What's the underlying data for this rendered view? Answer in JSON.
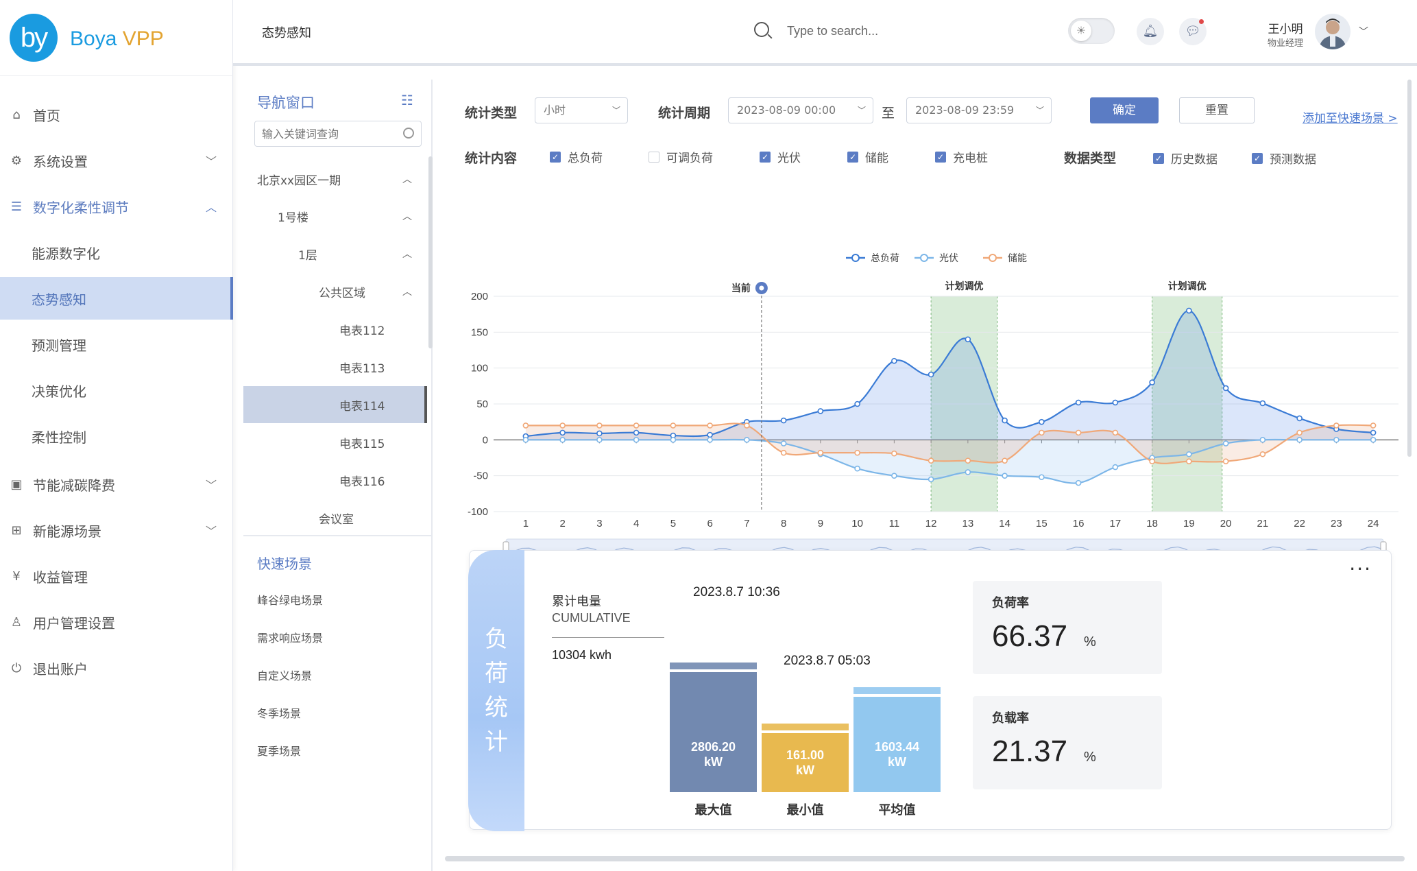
{
  "app": {
    "logo_mark": "by",
    "brand_part1": "Boya",
    "brand_part2": "VPP",
    "brand_color": "#1a9be0",
    "brand_accent": "#e3a431"
  },
  "sidebar": {
    "items": [
      {
        "label": "首页",
        "icon": "home-icon"
      },
      {
        "label": "系统设置",
        "icon": "gear-icon"
      },
      {
        "label": "数字化柔性调节",
        "icon": "sliders-icon"
      },
      {
        "label": "能源数字化"
      },
      {
        "label": "态势感知"
      },
      {
        "label": "预测管理"
      },
      {
        "label": "决策优化"
      },
      {
        "label": "柔性控制"
      },
      {
        "label": "节能减碳降费",
        "icon": "calendar-icon"
      },
      {
        "label": "新能源场景",
        "icon": "grid-icon"
      },
      {
        "label": "收益管理",
        "icon": "yen-icon"
      },
      {
        "label": "用户管理设置",
        "icon": "user-icon"
      },
      {
        "label": "退出账户",
        "icon": "power-icon"
      }
    ]
  },
  "topbar": {
    "title": "态势感知",
    "search_placeholder": "Type to search...",
    "user_name": "王小明",
    "user_role": "物业经理"
  },
  "navpanel": {
    "title": "导航窗口",
    "search_placeholder": "输入关键词查询",
    "tree": [
      "北京xx园区一期",
      "1号楼",
      "1层",
      "公共区域",
      "电表112",
      "电表113",
      "电表114",
      "电表115",
      "电表116",
      "会议室"
    ],
    "quick_title": "快速场景",
    "quick_items": [
      "峰谷绿电场景",
      "需求响应场景",
      "自定义场景",
      "冬季场景",
      "夏季场景"
    ]
  },
  "filters": {
    "stat_type_label": "统计类型",
    "stat_type_value": "小时",
    "period_label": "统计周期",
    "period_start": "2023-08-09 00:00",
    "period_sep": "至",
    "period_end": "2023-08-09 23:59",
    "confirm": "确定",
    "reset": "重置",
    "add_quick": "添加至快速场景 >",
    "content_label": "统计内容",
    "content_options": [
      {
        "label": "总负荷",
        "checked": true
      },
      {
        "label": "可调负荷",
        "checked": false
      },
      {
        "label": "光伏",
        "checked": true
      },
      {
        "label": "储能",
        "checked": true
      },
      {
        "label": "充电桩",
        "checked": true
      }
    ],
    "data_type_label": "数据类型",
    "data_type_options": [
      {
        "label": "历史数据",
        "checked": true
      },
      {
        "label": "预测数据",
        "checked": true
      }
    ]
  },
  "chart_data": {
    "type": "line",
    "x": [
      1,
      2,
      3,
      4,
      5,
      6,
      7,
      8,
      9,
      10,
      11,
      12,
      13,
      14,
      15,
      16,
      17,
      18,
      19,
      20,
      21,
      22,
      23,
      24
    ],
    "ylim": [
      -100,
      200
    ],
    "yticks": [
      200,
      150,
      100,
      50,
      0,
      -50,
      -100
    ],
    "legend": [
      "总负荷",
      "光伏",
      "储能"
    ],
    "legend_position": "top-center",
    "series": [
      {
        "name": "总负荷",
        "color": "#3a7bd5",
        "values": [
          5,
          10,
          9,
          10,
          6,
          7,
          25,
          27,
          40,
          50,
          110,
          91,
          140,
          27,
          25,
          52,
          52,
          80,
          180,
          72,
          51,
          30,
          15,
          10
        ]
      },
      {
        "name": "光伏",
        "color": "#7cb6e8",
        "values": [
          0,
          0,
          0,
          0,
          0,
          0,
          0,
          -5,
          -20,
          -40,
          -50,
          -55,
          -45,
          -50,
          -52,
          -60,
          -38,
          -25,
          -20,
          -5,
          0,
          0,
          0,
          0
        ]
      },
      {
        "name": "储能",
        "color": "#f0a878",
        "values": [
          20,
          20,
          20,
          20,
          20,
          20,
          20,
          -18,
          -18,
          -18,
          -19,
          -29,
          -29,
          -29,
          10,
          10,
          10,
          -30,
          -30,
          -30,
          -20,
          10,
          20,
          20
        ]
      }
    ],
    "annotations": [
      {
        "type": "marker",
        "x": 7.4,
        "label": "当前"
      },
      {
        "type": "band",
        "from": 12,
        "to": 13.8,
        "label": "计划调优"
      },
      {
        "type": "band",
        "from": 18,
        "to": 19.9,
        "label": "计划调优"
      }
    ],
    "grid": true
  },
  "stats": {
    "side_title": [
      "负",
      "荷",
      "统",
      "计"
    ],
    "cumulative_title": "累计电量",
    "cumulative_en": "CUMULATIVE",
    "cumulative_value": "10304 kwh",
    "max_time": "2023.8.7   10:36",
    "min_time": "2023.8.7   05:03",
    "bars": [
      {
        "value": "2806.20",
        "unit": "kW",
        "label": "最大值",
        "color": "#7289b0",
        "level": 0.97
      },
      {
        "value": "161.00",
        "unit": "kW",
        "label": "最小值",
        "color": "#e8b94f",
        "level": 0.48
      },
      {
        "value": "1603.44",
        "unit": "kW",
        "label": "平均值",
        "color": "#92c8ef",
        "level": 0.77
      }
    ],
    "kpis": [
      {
        "title": "负荷率",
        "value": "66.37",
        "unit": "%"
      },
      {
        "title": "负载率",
        "value": "21.37",
        "unit": "%"
      }
    ]
  }
}
